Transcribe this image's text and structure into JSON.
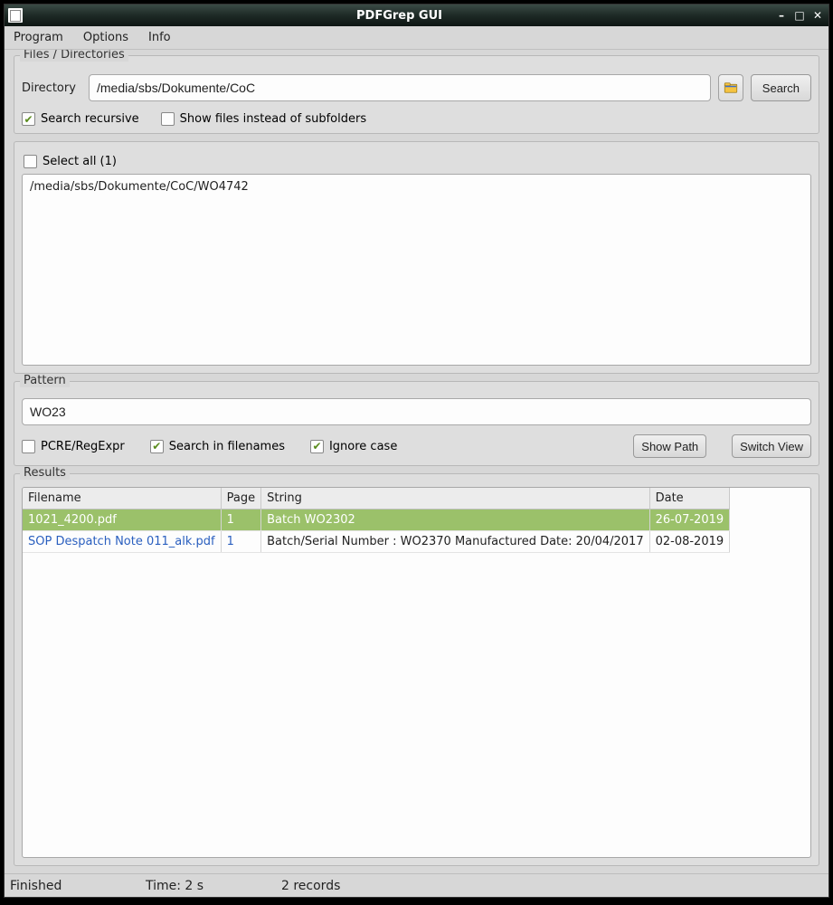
{
  "window": {
    "title": "PDFGrep GUI"
  },
  "menu": {
    "program": "Program",
    "options": "Options",
    "info": "Info"
  },
  "files": {
    "group_title": "Files / Directories",
    "dir_label": "Directory",
    "dir_value": "/media/sbs/Dokumente/CoC",
    "search_btn": "Search",
    "recursive_label": "Search recursive",
    "recursive_checked": true,
    "show_files_label": "Show files instead of subfolders",
    "show_files_checked": false,
    "select_all_label": "Select all (1)",
    "select_all_checked": false,
    "list_item_0": "/media/sbs/Dokumente/CoC/WO4742"
  },
  "pattern": {
    "group_title": "Pattern",
    "value": "WO23",
    "pcre_label": "PCRE/RegExpr",
    "pcre_checked": false,
    "in_filenames_label": "Search in filenames",
    "in_filenames_checked": true,
    "ignore_case_label": "Ignore case",
    "ignore_case_checked": true,
    "show_path_btn": "Show Path",
    "switch_view_btn": "Switch View"
  },
  "results": {
    "group_title": "Results",
    "col_filename": "Filename",
    "col_page": "Page",
    "col_string": "String",
    "col_date": "Date",
    "rows": [
      {
        "filename": "1021_4200.pdf",
        "page": "1",
        "string": "Batch WO2302",
        "date": "26-07-2019",
        "selected": true
      },
      {
        "filename": "SOP Despatch Note 011_alk.pdf",
        "page": "1",
        "string": "Batch/Serial Number : WO2370 Manufactured Date: 20/04/2017",
        "date": "02-08-2019",
        "selected": false
      }
    ],
    "r0_filename": "1021_4200.pdf",
    "r0_page": "1",
    "r0_string": "Batch WO2302",
    "r0_date": "26-07-2019",
    "r1_filename": "SOP Despatch Note 011_alk.pdf",
    "r1_page": "1",
    "r1_string": "Batch/Serial Number : WO2370 Manufactured Date: 20/04/2017",
    "r1_date": "02-08-2019"
  },
  "status": {
    "state": "Finished",
    "time": "Time: 2 s",
    "records": "2  records"
  }
}
